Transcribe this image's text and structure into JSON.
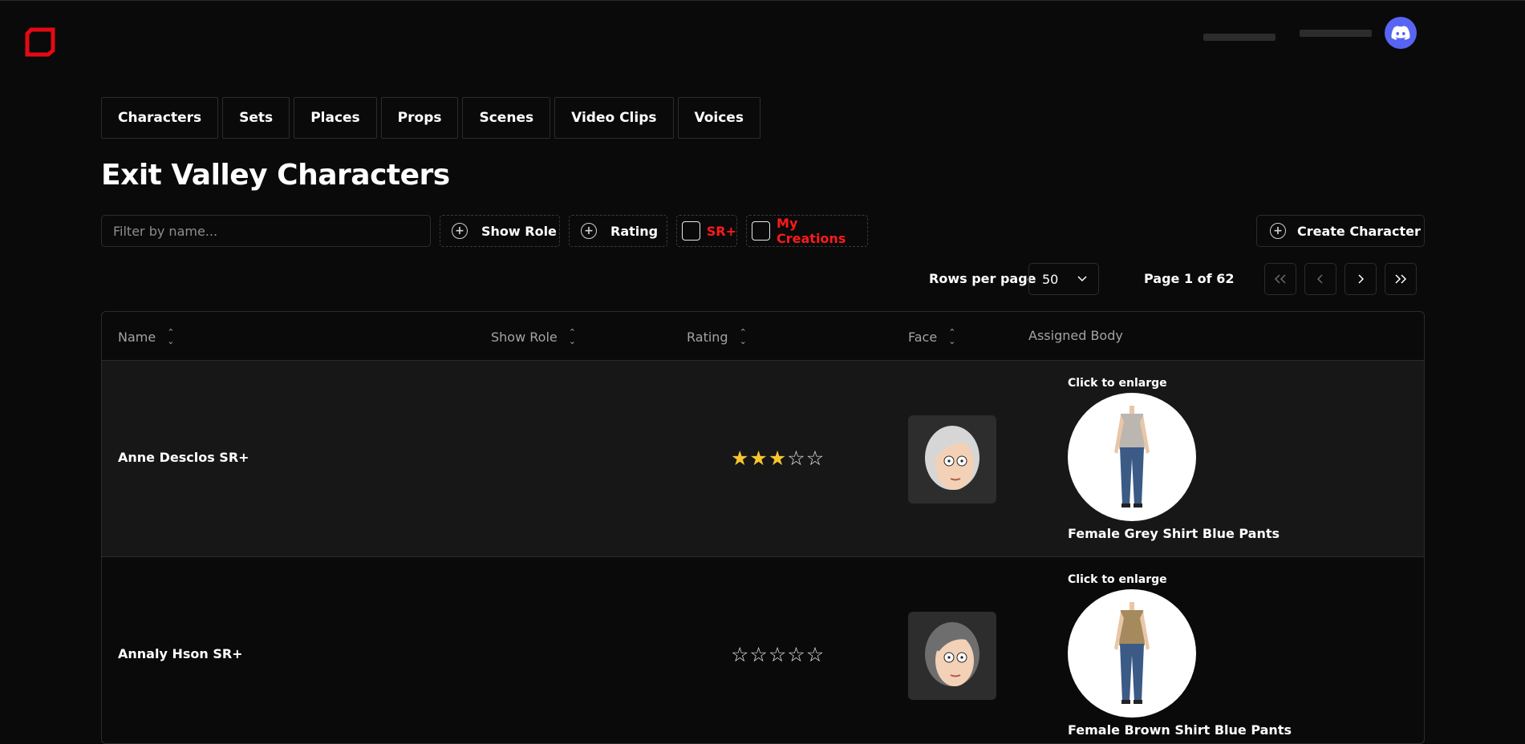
{
  "brand": {
    "logo": "logo-icon",
    "discord_icon": "discord-icon"
  },
  "tabs": [
    "Characters",
    "Sets",
    "Places",
    "Props",
    "Scenes",
    "Video Clips",
    "Voices"
  ],
  "page_title": "Exit Valley Characters",
  "filters": {
    "name_placeholder": "Filter by name...",
    "show_role": "Show Role",
    "rating": "Rating",
    "sr_plus": "SR+",
    "my_creations": "My Creations",
    "create_character": "Create Character"
  },
  "pagination": {
    "rows_label": "Rows per page",
    "rows_value": "50",
    "page_info": "Page 1 of 62",
    "first": "<<",
    "prev": "<",
    "next": ">",
    "last": ">>"
  },
  "table": {
    "headers": {
      "name": "Name",
      "show_role": "Show Role",
      "rating": "Rating",
      "face": "Face",
      "body": "Assigned Body"
    },
    "rows": [
      {
        "name": "Anne Desclos SR+",
        "show_role": "",
        "rating": 3,
        "rating_max": 5,
        "enlarge": "Click to enlarge",
        "body": "Female Grey Shirt Blue Pants",
        "shirt_color": "#bcb6b0",
        "hair_color": "#d6d6d6"
      },
      {
        "name": "Annaly Hson SR+",
        "show_role": "",
        "rating": 0,
        "rating_max": 5,
        "enlarge": "Click to enlarge",
        "body": "Female Brown Shirt Blue Pants",
        "shirt_color": "#a48a5c",
        "hair_color": "#6e6e6e"
      }
    ]
  },
  "colors": {
    "accent_red": "#ff1a1a",
    "star_gold": "#f7c531",
    "discord": "#5865f2"
  }
}
